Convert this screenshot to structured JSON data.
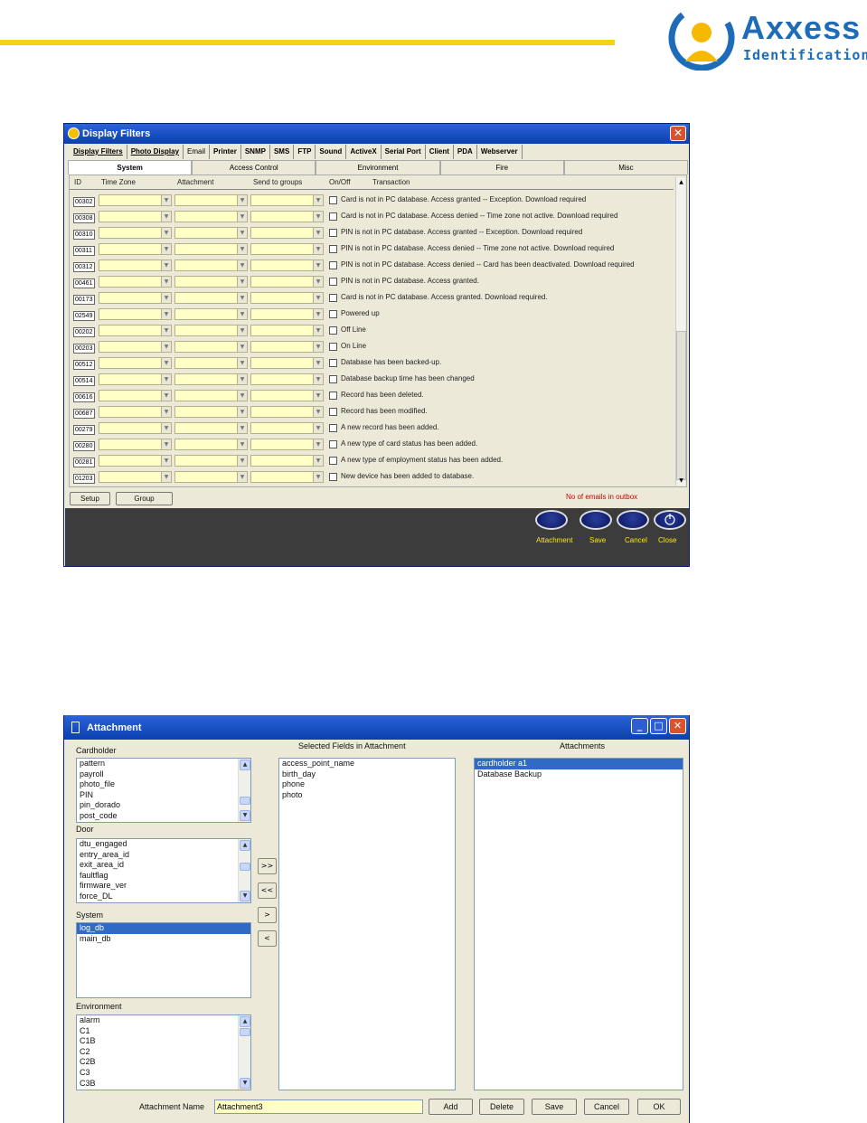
{
  "brand": {
    "name": "Axxess",
    "subtitle": "Identification",
    "rule_color": "#f5d418",
    "logo_color": "#1e6bb8"
  },
  "display_filters": {
    "title": "Display Filters",
    "top_tabs": [
      "Display Filters",
      "Photo Display",
      "Email",
      "Printer",
      "SNMP",
      "SMS",
      "FTP",
      "Sound",
      "ActiveX",
      "Serial Port",
      "Client",
      "PDA",
      "Webserver"
    ],
    "sub_tabs": [
      "System",
      "Access Control",
      "Environment",
      "Fire",
      "Misc"
    ],
    "columns": {
      "id": "ID",
      "time_zone": "Time Zone",
      "attachment": "Attachment",
      "send_to_groups": "Send to groups",
      "on_off": "On/Off",
      "transaction": "Transaction"
    },
    "rows": [
      {
        "id": "00302",
        "text": "Card is not in PC database. Access granted -- Exception. Download required"
      },
      {
        "id": "00308",
        "text": "Card is not in PC database. Access denied -- Time zone not active. Download required"
      },
      {
        "id": "00310",
        "text": "PIN is not in PC database. Access granted -- Exception. Download required"
      },
      {
        "id": "00311",
        "text": "PIN is not in PC database. Access denied -- Time zone not active. Download required"
      },
      {
        "id": "00312",
        "text": "PIN is not in PC database. Access denied -- Card has been deactivated. Download required"
      },
      {
        "id": "00461",
        "text": "PIN is not in PC database. Access granted."
      },
      {
        "id": "00173",
        "text": "Card is not in PC database. Access granted. Download required."
      },
      {
        "id": "02549",
        "text": "Powered up"
      },
      {
        "id": "00202",
        "text": "Off Line"
      },
      {
        "id": "00203",
        "text": "On Line"
      },
      {
        "id": "00512",
        "text": "Database has been backed-up."
      },
      {
        "id": "00514",
        "text": "Database backup time has been changed"
      },
      {
        "id": "00616",
        "text": "Record has been deleted."
      },
      {
        "id": "00687",
        "text": "Record has been modified."
      },
      {
        "id": "00279",
        "text": "A new record has been added."
      },
      {
        "id": "00280",
        "text": "A new type of card status has been added."
      },
      {
        "id": "00281",
        "text": "A new type of employment status has been added."
      },
      {
        "id": "01203",
        "text": "New device has been added to database."
      }
    ],
    "setup_label": "Setup",
    "group_label": "Group",
    "outbox_status": "No of emails in outbox",
    "actions": [
      "Attachment",
      "Save",
      "Cancel",
      "Close"
    ]
  },
  "attachment": {
    "title": "Attachment",
    "cardholder_label": "Cardholder",
    "cardholder_items": [
      "pattern",
      "payroll",
      "photo_file",
      "PIN",
      "pin_dorado",
      "post_code"
    ],
    "door_label": "Door",
    "door_items": [
      "dtu_engaged",
      "entry_area_id",
      "exit_area_id",
      "faultflag",
      "firmware_ver",
      "force_DL"
    ],
    "system_label": "System",
    "system_items": [
      "log_db",
      "main_db"
    ],
    "environment_label": "Environment",
    "environment_items": [
      "alarm",
      "C1",
      "C1B",
      "C2",
      "C2B",
      "C3",
      "C3B"
    ],
    "selected_fields_label": "Selected Fields in Attachment",
    "selected_fields": [
      "access_point_name",
      "birth_day",
      "phone",
      "photo"
    ],
    "attachments_label": "Attachments",
    "attachments": [
      "cardholder a1",
      "Database Backup"
    ],
    "move_buttons": [
      ">>",
      "<<",
      ">",
      "<"
    ],
    "name_label": "Attachment Name",
    "name_value": "Attachment3",
    "buttons": {
      "add": "Add",
      "delete": "Delete",
      "save": "Save",
      "cancel": "Cancel",
      "ok": "OK"
    }
  }
}
